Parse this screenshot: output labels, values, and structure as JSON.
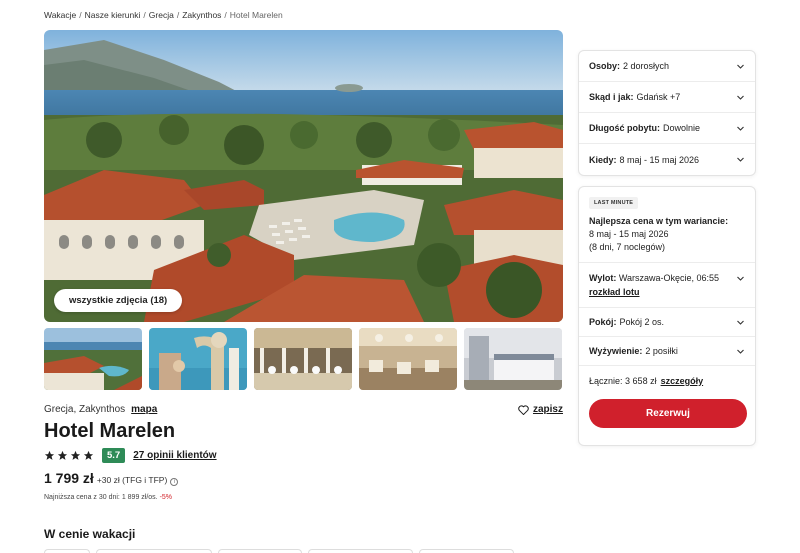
{
  "breadcrumb": {
    "items": [
      "Wakacje",
      "Nasze kierunki",
      "Grecja",
      "Zakynthos"
    ],
    "current": "Hotel Marelen"
  },
  "gallery": {
    "all_photos_label": "wszystkie zdjęcia (18)",
    "thumbnails": [
      "thumb-1",
      "thumb-2",
      "thumb-3",
      "thumb-4",
      "thumb-5"
    ]
  },
  "hotel": {
    "location": "Grecja, Zakynthos",
    "map_label": "mapa",
    "save_label": "zapisz",
    "name": "Hotel Marelen",
    "stars": 4,
    "rating": "5.7",
    "reviews_label": "27 opinii klientów",
    "price": "1 799 zł",
    "price_extra": "+30 zł (TFG i TFP)",
    "lowest_price_text": "Najniższa cena z 30 dni: 1 899 zł/os.",
    "lowest_discount": "-5%"
  },
  "section": {
    "title": "W cenie wakacji"
  },
  "search_panel": {
    "persons": {
      "label": "Osoby:",
      "value": "2 dorosłych"
    },
    "from": {
      "label": "Skąd i jak:",
      "value": "Gdańsk +7"
    },
    "duration": {
      "label": "Długość pobytu:",
      "value": "Dowolnie"
    },
    "when": {
      "label": "Kiedy:",
      "value": "8 maj - 15 maj 2026"
    }
  },
  "offer_panel": {
    "badge": "LAST MINUTE",
    "best_label": "Najlepsza cena w tym wariancie:",
    "best_dates": "8 maj - 15 maj 2026",
    "best_nights": "(8 dni, 7 noclegów)",
    "flight": {
      "label": "Wylot:",
      "value": "Warszawa-Okęcie, 06:55",
      "link": "rozkład lotu"
    },
    "room": {
      "label": "Pokój:",
      "value": "Pokój 2 os."
    },
    "meals": {
      "label": "Wyżywienie:",
      "value": "2 posiłki"
    },
    "total": {
      "label": "Łącznie:",
      "value": "3 658 zł",
      "link": "szczegóły"
    },
    "reserve_label": "Rezerwuj"
  },
  "colors": {
    "accent": "#d0202c",
    "rating": "#2e8b57"
  }
}
